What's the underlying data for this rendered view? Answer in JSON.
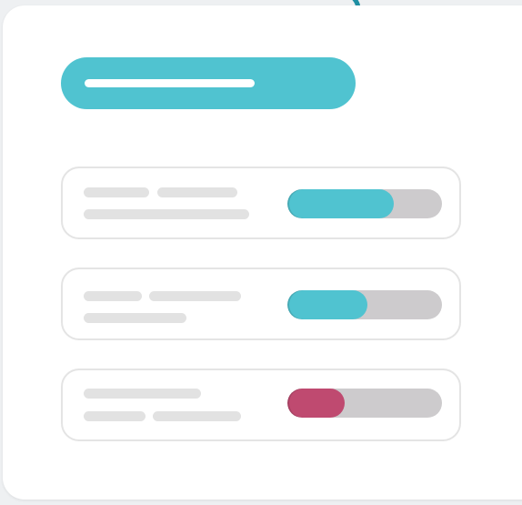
{
  "colors": {
    "accent": "#50c3d0",
    "accent_dark": "#1e8fa3",
    "danger": "#bf4a70",
    "track": "#cdcbcd",
    "placeholder": "#e2e2e2",
    "border": "#e4e4e4"
  },
  "rows": [
    {
      "progress": 0.69,
      "status": "accent"
    },
    {
      "progress": 0.52,
      "status": "accent"
    },
    {
      "progress": 0.37,
      "status": "danger"
    }
  ]
}
